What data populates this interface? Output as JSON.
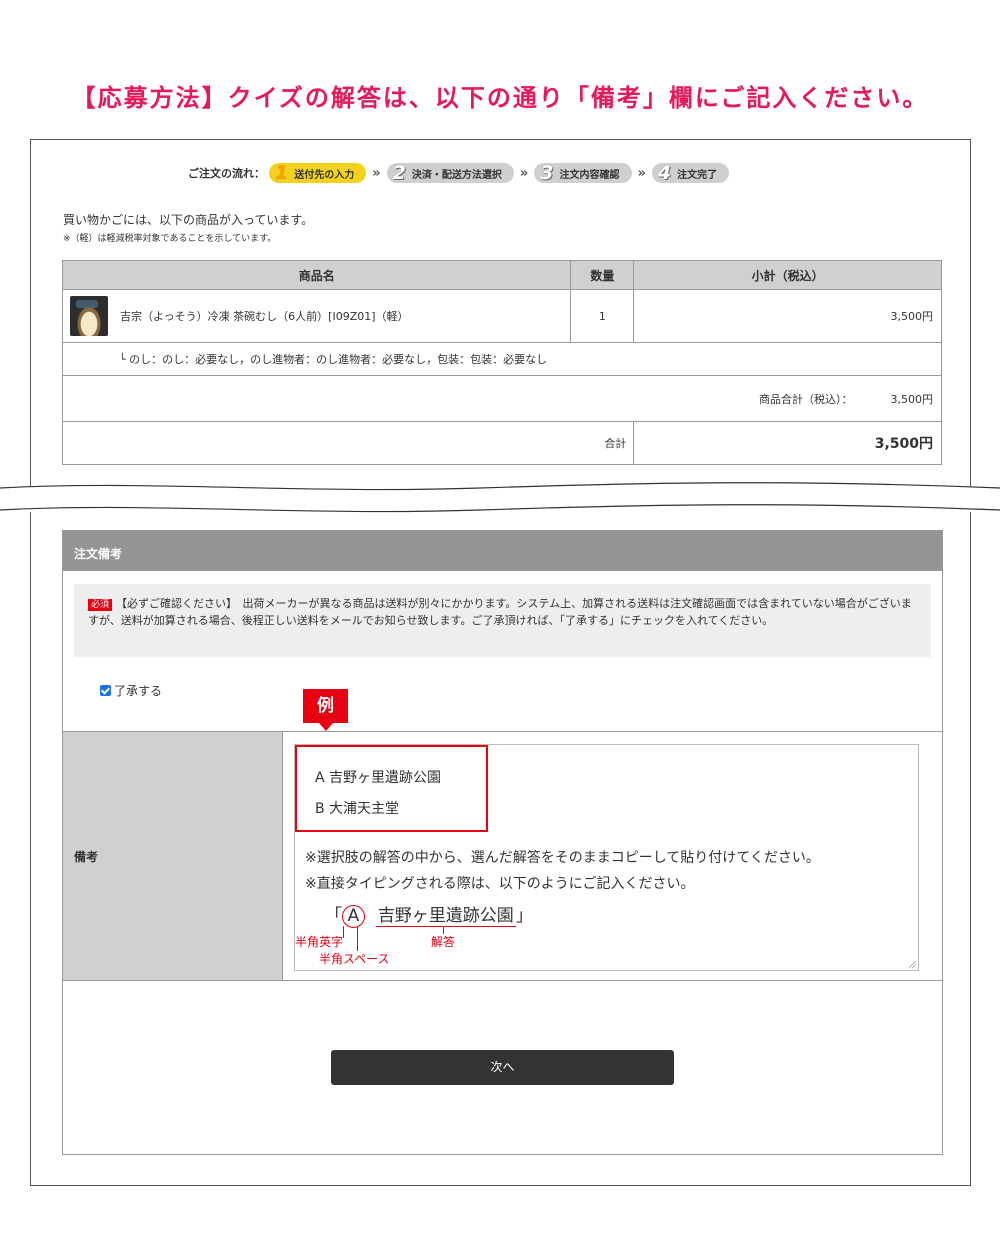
{
  "heading": "【応募方法】クイズの解答は、以下の通り「備考」欄にご記入ください。",
  "flow": {
    "label": "ご注文の流れ：",
    "steps": [
      {
        "num": "1",
        "label": "送付先の入力"
      },
      {
        "num": "2",
        "label": "決済・配送方法選択"
      },
      {
        "num": "3",
        "label": "注文内容確認"
      },
      {
        "num": "4",
        "label": "注文完了"
      }
    ],
    "separator": "»"
  },
  "cart": {
    "intro": "買い物かごには、以下の商品が入っています。",
    "note": "※（軽）は軽減税率対象であることを示しています。",
    "headers": {
      "product": "商品名",
      "qty": "数量",
      "subtotal": "小計（税込）"
    },
    "item": {
      "name": "吉宗（よっそう）冷凍 茶碗むし（6人前）[I09Z01]（軽）",
      "qty": "1",
      "price": "3,500円",
      "options": "└ のし：のし：必要なし，のし進物者：のし進物者：必要なし，包装：包装：必要なし"
    },
    "goods_total_label": "商品合計（税込）：",
    "goods_total": "3,500円",
    "total_label": "合計",
    "total": "3,500円"
  },
  "remarks": {
    "panel_title": "注文備考",
    "badge": "必須",
    "notice": "【必ずご確認ください】　出荷メーカーが異なる商品は送料が別々にかかります。システム上、加算される送料は注文確認画面では含まれていない場合がございますが、送料が加算される場合、後程正しい送料をメールでお知らせ致します。ご了承頂ければ、「了承する」にチェックを入れてください。",
    "agree_label": "了承する",
    "agree_checked": true,
    "example_tag": "例",
    "row_label": "備考",
    "example_lines": [
      "A 吉野ヶ里遺跡公園",
      "B 大浦天主堂"
    ],
    "guide_lines": [
      "※選択肢の解答の中から、選んだ解答をそのままコピーして貼り付けてください。",
      "※直接タイピングされる際は、以下のようにご記入ください。"
    ],
    "sample": {
      "open": "「",
      "letter": "A",
      "answer": "吉野ヶ里遺跡公園",
      "close": "」"
    },
    "annotations": {
      "letter": "半角英字",
      "space": "半角スペース",
      "answer": "解答"
    }
  },
  "next_button": "次へ",
  "colors": {
    "accent": "#e6195a",
    "red": "#e60012",
    "active_step": "#f4d21b"
  }
}
